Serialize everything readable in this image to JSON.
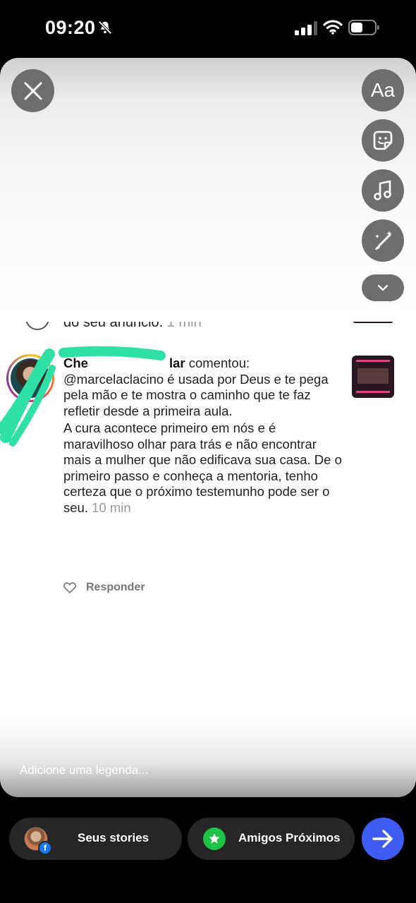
{
  "status_bar": {
    "time": "09:20"
  },
  "toolbar": {
    "text_tool_label": "Aa"
  },
  "previous_comment": {
    "text": "do seu anúncio.",
    "time": "1 min"
  },
  "comment": {
    "name_fragment_start": "Che",
    "name_fragment_end": "lar",
    "action": "comentou:",
    "paragraph1": "@marcelaclacino é usada por Deus e te pega pela mão e te mostra o caminho que te faz refletir desde a primeira aula.",
    "paragraph2": "A cura acontece primeiro em nós e é maravilhoso olhar para trás e não encontrar mais a mulher que não edificava sua casa. De o primeiro passo e  conheça a mentoria, tenho certeza que o próximo testemunho pode ser o seu.",
    "time": "10 min",
    "reply_label": "Responder"
  },
  "caption": {
    "placeholder": "Adicione uma legenda..."
  },
  "bottom_bar": {
    "your_stories_label": "Seus stories",
    "close_friends_label": "Amigos Próximos"
  },
  "colors": {
    "send_button": "#3f5cf2",
    "close_friends": "#1ec247",
    "redaction": "#2fe0a6"
  }
}
